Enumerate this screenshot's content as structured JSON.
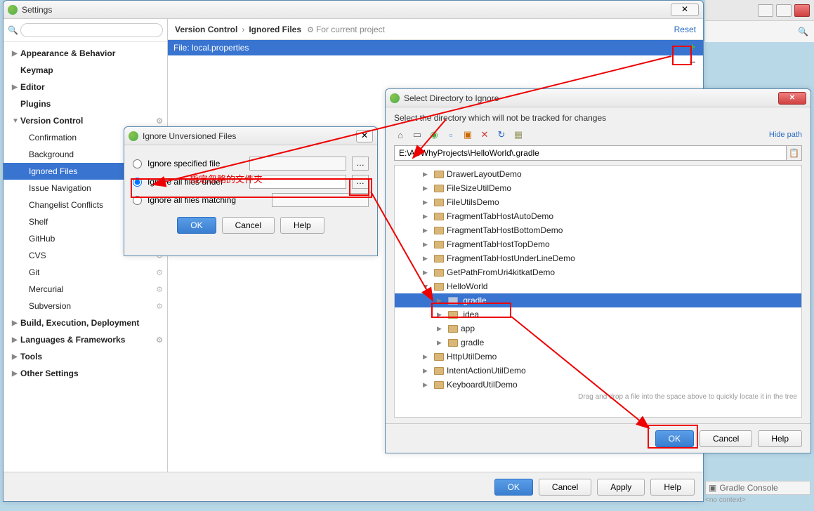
{
  "bg": {
    "gradle_console": "Gradle Console",
    "no_context": "<no context>"
  },
  "settings": {
    "title": "Settings",
    "search_placeholder": "",
    "tree": {
      "appearance": "Appearance & Behavior",
      "keymap": "Keymap",
      "editor": "Editor",
      "plugins": "Plugins",
      "version_control": "Version Control",
      "confirmation": "Confirmation",
      "background": "Background",
      "ignored_files": "Ignored Files",
      "issue_navigation": "Issue Navigation",
      "changelist_conflicts": "Changelist Conflicts",
      "shelf": "Shelf",
      "github": "GitHub",
      "cvs": "CVS",
      "git": "Git",
      "mercurial": "Mercurial",
      "subversion": "Subversion",
      "build": "Build, Execution, Deployment",
      "languages": "Languages & Frameworks",
      "tools": "Tools",
      "other": "Other Settings"
    },
    "crumb1": "Version Control",
    "crumb2": "Ignored Files",
    "for_project": "For current project",
    "reset": "Reset",
    "list_row": "File: local.properties",
    "ok": "OK",
    "cancel": "Cancel",
    "apply": "Apply",
    "help": "Help"
  },
  "ignore_unv": {
    "title": "Ignore Unversioned Files",
    "r1": "Ignore specified file",
    "r2": "Ignore all files under",
    "r3": "Ignore all files matching",
    "annotation": "指定忽略的文件夹",
    "ok": "OK",
    "cancel": "Cancel",
    "help": "Help"
  },
  "seldir": {
    "title": "Select Directory to Ignore",
    "hint": "Select the directory which will not be tracked for changes",
    "hide_path": "Hide path",
    "path": "E:\\ASWhyProjects\\HelloWorld\\.gradle",
    "nodes": [
      "DrawerLayoutDemo",
      "FileSizeUtilDemo",
      "FileUtilsDemo",
      "FragmentTabHostAutoDemo",
      "FragmentTabHostBottomDemo",
      "FragmentTabHostTopDemo",
      "FragmentTabHostUnderLineDemo",
      "GetPathFromUri4kitkatDemo"
    ],
    "hello": "HelloWorld",
    "children": [
      ".gradle",
      ".idea",
      "app",
      "gradle"
    ],
    "nodes2": [
      "HttpUtilDemo",
      "IntentActionUtilDemo",
      "KeyboardUtilDemo"
    ],
    "draghint": "Drag and drop a file into the space above to quickly locate it in the tree",
    "ok": "OK",
    "cancel": "Cancel",
    "help": "Help"
  }
}
